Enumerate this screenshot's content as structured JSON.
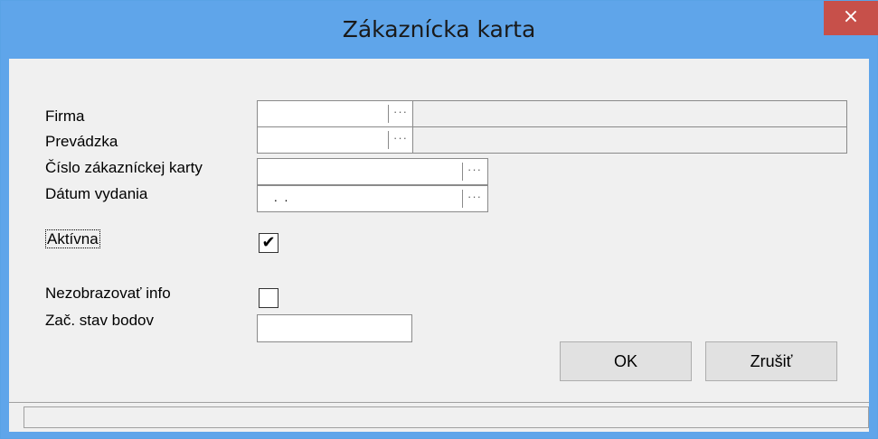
{
  "window": {
    "title": "Zákaznícka karta",
    "close_glyph": "×"
  },
  "form": {
    "firma_label": "Firma",
    "prevadzka_label": "Prevádzka",
    "cislo_label": "Číslo zákazníckej karty",
    "datum_label": "Dátum vydania",
    "datum_value": " .  .",
    "aktivna_label": "Aktívna",
    "aktivna_checked": "✔",
    "nezobrazovat_label": "Nezobrazovať info",
    "zac_stav_label": "Zač. stav bodov",
    "ellipsis": "···"
  },
  "buttons": {
    "ok_label": "OK",
    "cancel_label": "Zrušiť"
  },
  "colors": {
    "titlebar": "#5fa5ea",
    "close": "#c7504a",
    "client": "#f0f0f0"
  }
}
